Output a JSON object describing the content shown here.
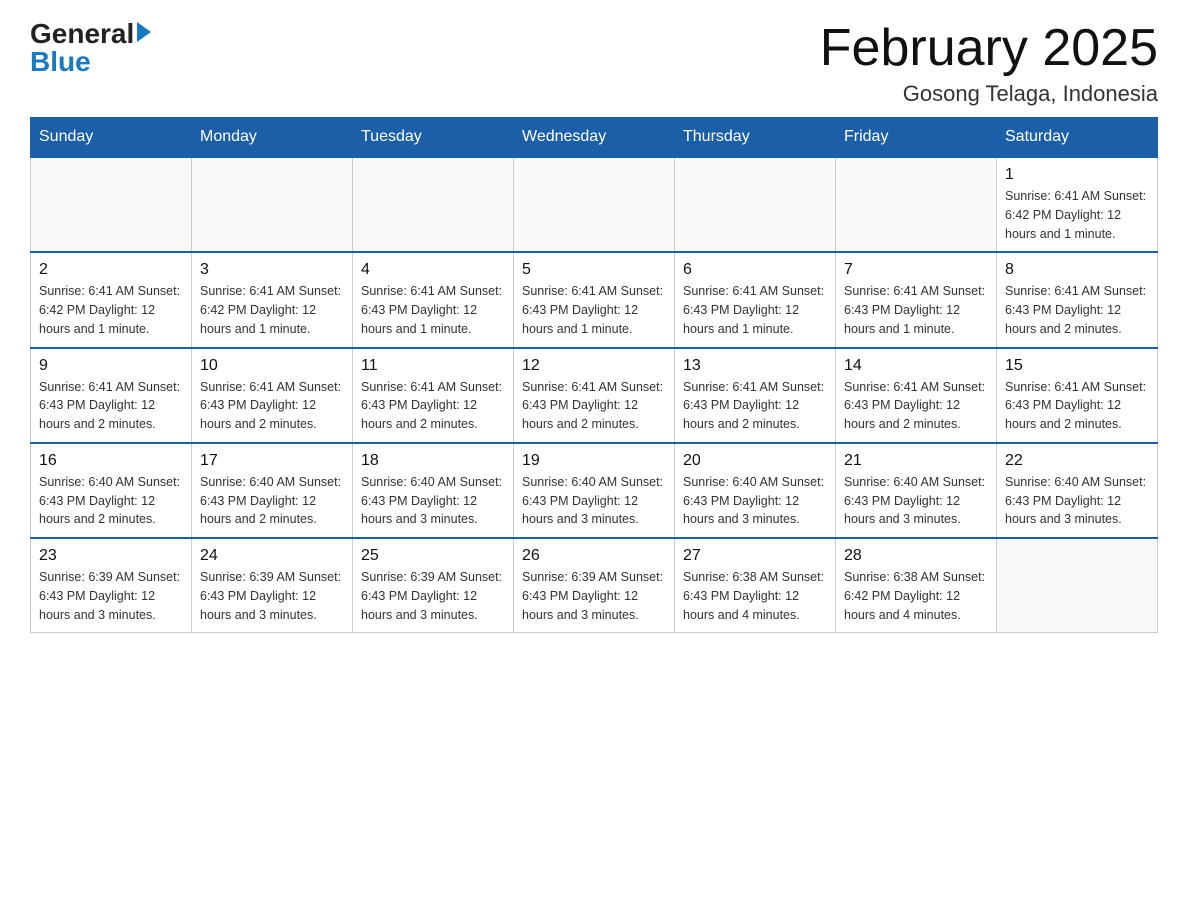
{
  "logo": {
    "general": "General",
    "blue": "Blue"
  },
  "title": "February 2025",
  "location": "Gosong Telaga, Indonesia",
  "days_of_week": [
    "Sunday",
    "Monday",
    "Tuesday",
    "Wednesday",
    "Thursday",
    "Friday",
    "Saturday"
  ],
  "weeks": [
    [
      {
        "day": "",
        "info": ""
      },
      {
        "day": "",
        "info": ""
      },
      {
        "day": "",
        "info": ""
      },
      {
        "day": "",
        "info": ""
      },
      {
        "day": "",
        "info": ""
      },
      {
        "day": "",
        "info": ""
      },
      {
        "day": "1",
        "info": "Sunrise: 6:41 AM\nSunset: 6:42 PM\nDaylight: 12 hours\nand 1 minute."
      }
    ],
    [
      {
        "day": "2",
        "info": "Sunrise: 6:41 AM\nSunset: 6:42 PM\nDaylight: 12 hours\nand 1 minute."
      },
      {
        "day": "3",
        "info": "Sunrise: 6:41 AM\nSunset: 6:42 PM\nDaylight: 12 hours\nand 1 minute."
      },
      {
        "day": "4",
        "info": "Sunrise: 6:41 AM\nSunset: 6:43 PM\nDaylight: 12 hours\nand 1 minute."
      },
      {
        "day": "5",
        "info": "Sunrise: 6:41 AM\nSunset: 6:43 PM\nDaylight: 12 hours\nand 1 minute."
      },
      {
        "day": "6",
        "info": "Sunrise: 6:41 AM\nSunset: 6:43 PM\nDaylight: 12 hours\nand 1 minute."
      },
      {
        "day": "7",
        "info": "Sunrise: 6:41 AM\nSunset: 6:43 PM\nDaylight: 12 hours\nand 1 minute."
      },
      {
        "day": "8",
        "info": "Sunrise: 6:41 AM\nSunset: 6:43 PM\nDaylight: 12 hours\nand 2 minutes."
      }
    ],
    [
      {
        "day": "9",
        "info": "Sunrise: 6:41 AM\nSunset: 6:43 PM\nDaylight: 12 hours\nand 2 minutes."
      },
      {
        "day": "10",
        "info": "Sunrise: 6:41 AM\nSunset: 6:43 PM\nDaylight: 12 hours\nand 2 minutes."
      },
      {
        "day": "11",
        "info": "Sunrise: 6:41 AM\nSunset: 6:43 PM\nDaylight: 12 hours\nand 2 minutes."
      },
      {
        "day": "12",
        "info": "Sunrise: 6:41 AM\nSunset: 6:43 PM\nDaylight: 12 hours\nand 2 minutes."
      },
      {
        "day": "13",
        "info": "Sunrise: 6:41 AM\nSunset: 6:43 PM\nDaylight: 12 hours\nand 2 minutes."
      },
      {
        "day": "14",
        "info": "Sunrise: 6:41 AM\nSunset: 6:43 PM\nDaylight: 12 hours\nand 2 minutes."
      },
      {
        "day": "15",
        "info": "Sunrise: 6:41 AM\nSunset: 6:43 PM\nDaylight: 12 hours\nand 2 minutes."
      }
    ],
    [
      {
        "day": "16",
        "info": "Sunrise: 6:40 AM\nSunset: 6:43 PM\nDaylight: 12 hours\nand 2 minutes."
      },
      {
        "day": "17",
        "info": "Sunrise: 6:40 AM\nSunset: 6:43 PM\nDaylight: 12 hours\nand 2 minutes."
      },
      {
        "day": "18",
        "info": "Sunrise: 6:40 AM\nSunset: 6:43 PM\nDaylight: 12 hours\nand 3 minutes."
      },
      {
        "day": "19",
        "info": "Sunrise: 6:40 AM\nSunset: 6:43 PM\nDaylight: 12 hours\nand 3 minutes."
      },
      {
        "day": "20",
        "info": "Sunrise: 6:40 AM\nSunset: 6:43 PM\nDaylight: 12 hours\nand 3 minutes."
      },
      {
        "day": "21",
        "info": "Sunrise: 6:40 AM\nSunset: 6:43 PM\nDaylight: 12 hours\nand 3 minutes."
      },
      {
        "day": "22",
        "info": "Sunrise: 6:40 AM\nSunset: 6:43 PM\nDaylight: 12 hours\nand 3 minutes."
      }
    ],
    [
      {
        "day": "23",
        "info": "Sunrise: 6:39 AM\nSunset: 6:43 PM\nDaylight: 12 hours\nand 3 minutes."
      },
      {
        "day": "24",
        "info": "Sunrise: 6:39 AM\nSunset: 6:43 PM\nDaylight: 12 hours\nand 3 minutes."
      },
      {
        "day": "25",
        "info": "Sunrise: 6:39 AM\nSunset: 6:43 PM\nDaylight: 12 hours\nand 3 minutes."
      },
      {
        "day": "26",
        "info": "Sunrise: 6:39 AM\nSunset: 6:43 PM\nDaylight: 12 hours\nand 3 minutes."
      },
      {
        "day": "27",
        "info": "Sunrise: 6:38 AM\nSunset: 6:43 PM\nDaylight: 12 hours\nand 4 minutes."
      },
      {
        "day": "28",
        "info": "Sunrise: 6:38 AM\nSunset: 6:42 PM\nDaylight: 12 hours\nand 4 minutes."
      },
      {
        "day": "",
        "info": ""
      }
    ]
  ]
}
